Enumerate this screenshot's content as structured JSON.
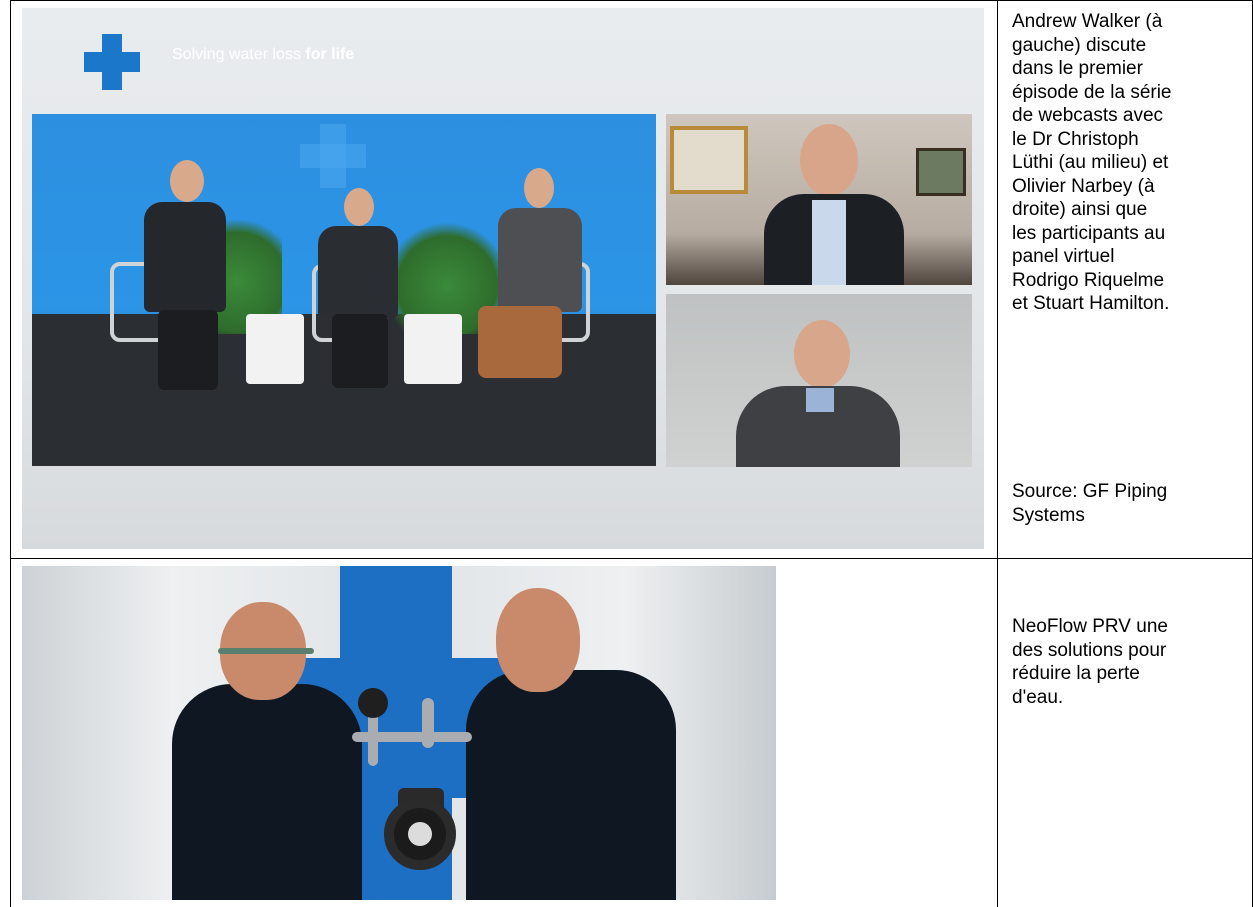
{
  "row1": {
    "photo": {
      "tagline_regular": "Solving water loss ",
      "tagline_bold": "for life"
    },
    "caption": "Andrew Walker (à\ngauche) discute\ndans le premier\népisode de la série\nde webcasts avec\nle Dr Christoph\nLüthi (au milieu) et\nOlivier Narbey (à\ndroite) ainsi que\nles participants au\npanel virtuel\nRodrigo Riquelme\net Stuart Hamilton.",
    "source": "Source: GF Piping\nSystems"
  },
  "row2": {
    "caption": "NeoFlow PRV une\ndes solutions pour\nréduire la perte\nd'eau."
  },
  "colors": {
    "brand_blue": "#1b77c9",
    "studio_blue": "#2c95e6"
  }
}
